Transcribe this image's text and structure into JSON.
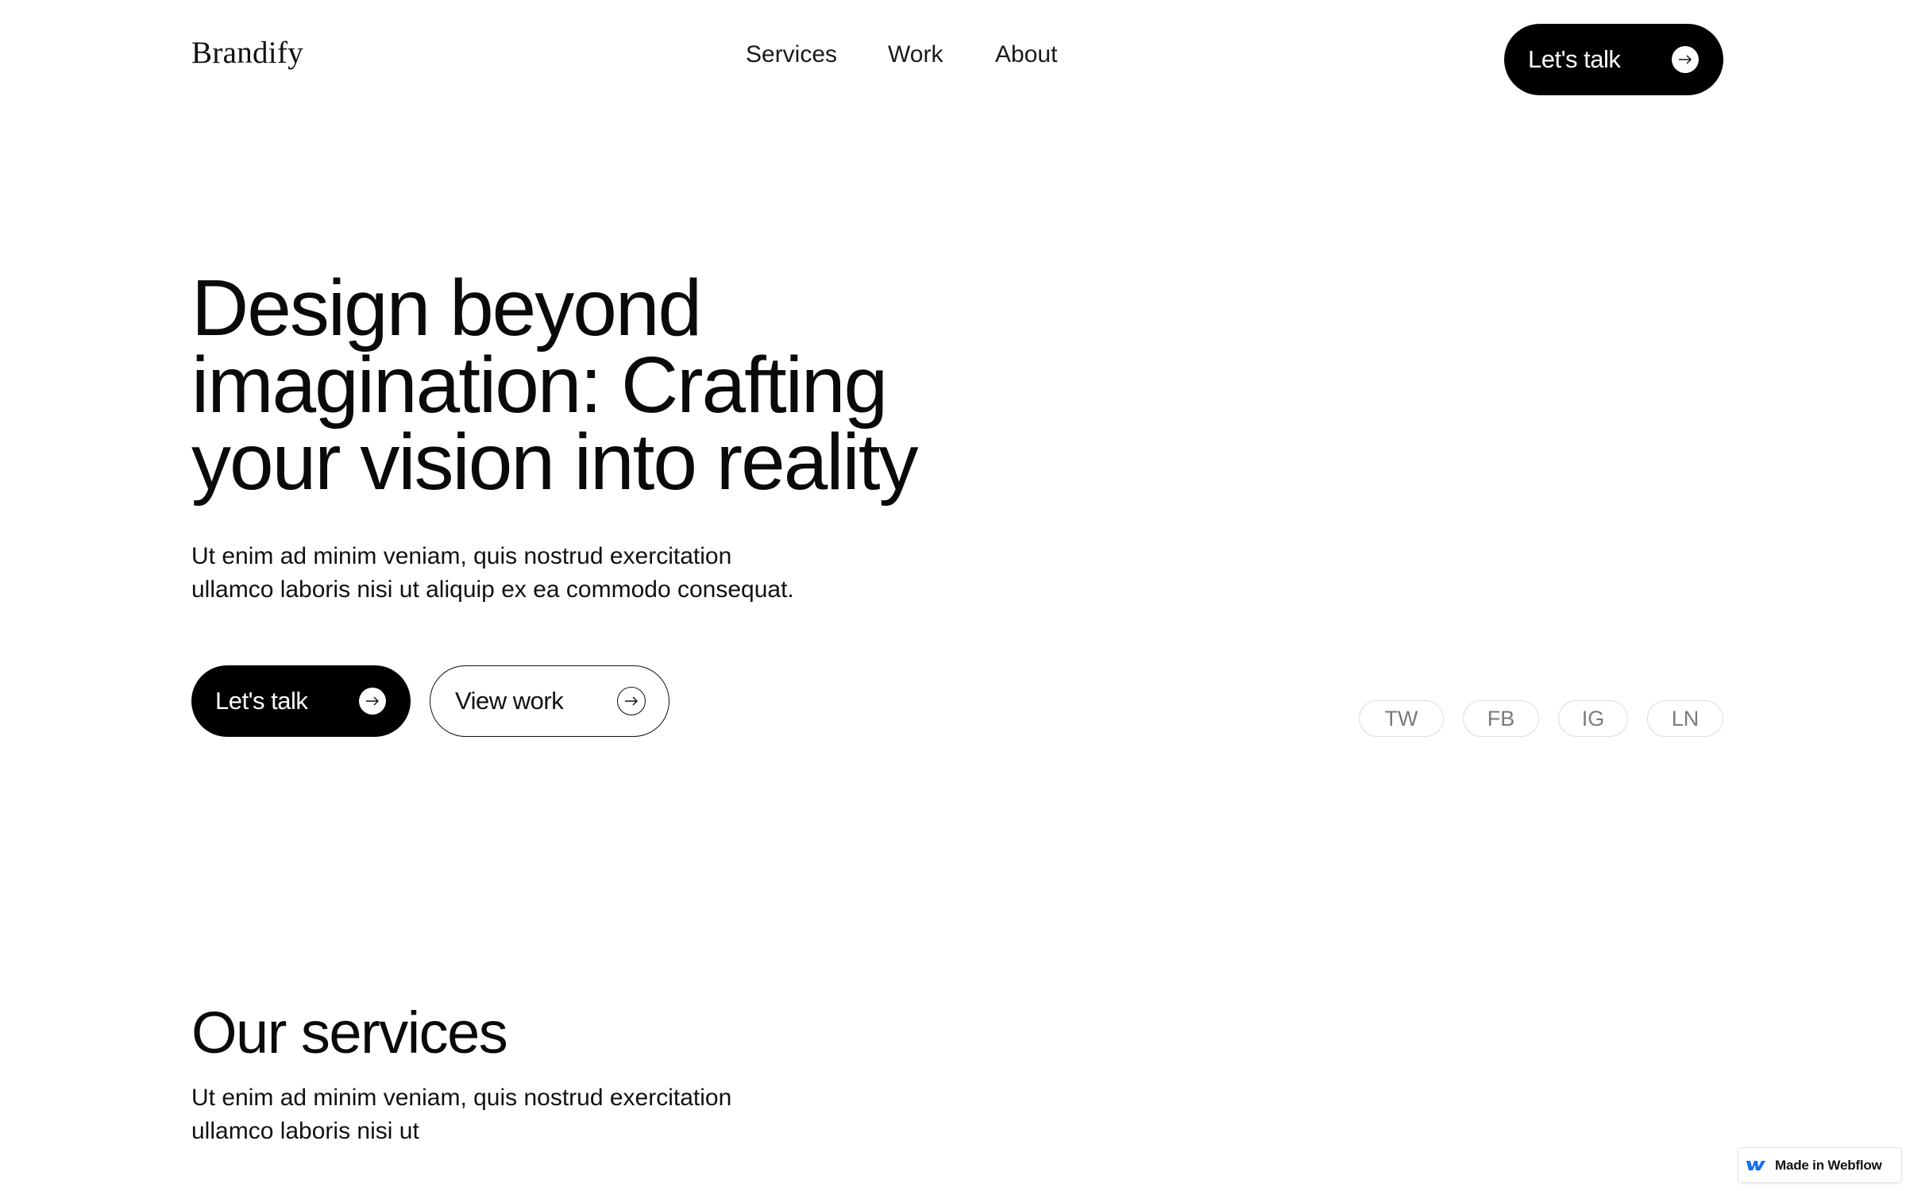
{
  "header": {
    "logo": "Brandify",
    "nav": [
      {
        "label": "Services"
      },
      {
        "label": "Work"
      },
      {
        "label": "About"
      }
    ],
    "cta_label": "Let's talk",
    "cta_icon": "arrow-right-icon"
  },
  "hero": {
    "title_lines": [
      "Design beyond",
      "imagination: Crafting",
      "your vision into reality"
    ],
    "paragraph_lines": [
      "Ut enim ad minim veniam, quis nostrud exercitation",
      "ullamco laboris nisi ut aliquip ex ea commodo consequat."
    ],
    "primary_button": {
      "label": "Let's talk",
      "icon": "arrow-right-icon"
    },
    "secondary_button": {
      "label": "View work",
      "icon": "arrow-right-icon"
    },
    "social": [
      {
        "label": "TW"
      },
      {
        "label": "FB"
      },
      {
        "label": "IG"
      },
      {
        "label": "LN"
      }
    ]
  },
  "services": {
    "title": "Our services",
    "paragraph_lines": [
      "Ut enim ad minim veniam, quis nostrud exercitation",
      "ullamco laboris nisi ut"
    ]
  },
  "badge": {
    "label": "Made in Webflow",
    "icon": "webflow-logo-icon",
    "icon_color": "#146ef5"
  },
  "colors": {
    "background": "#ffffff",
    "primary": "#000000",
    "social_text": "#7a7a7a",
    "social_border": "#dddddd"
  }
}
